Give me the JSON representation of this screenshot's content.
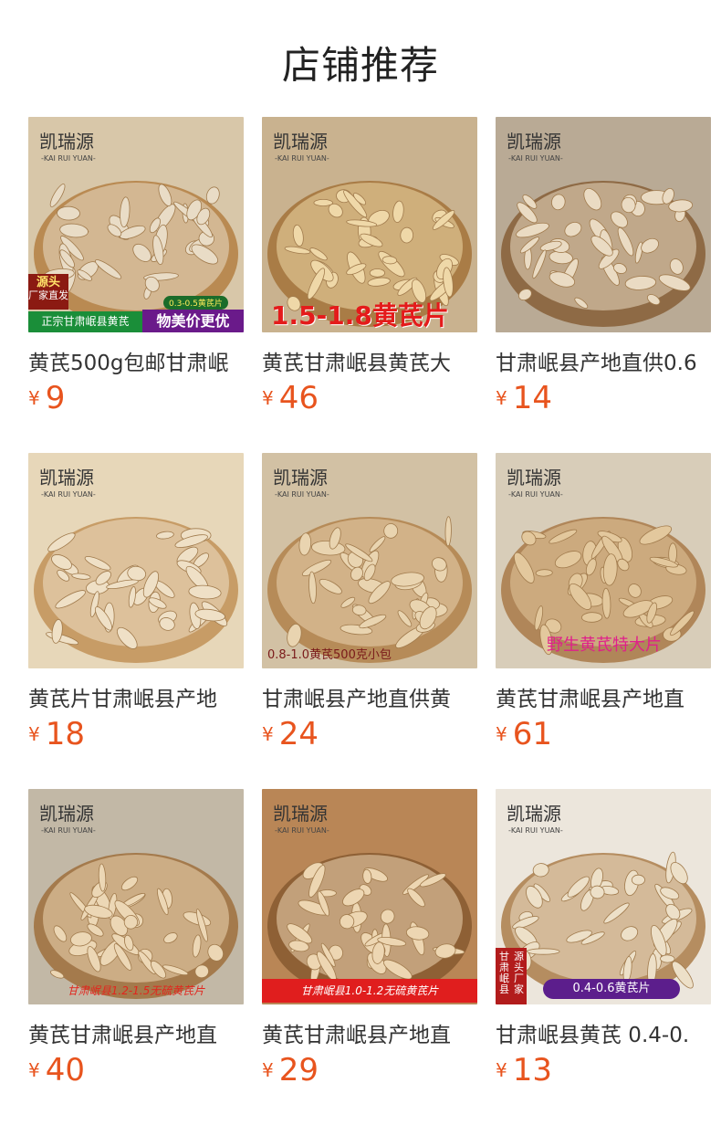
{
  "section_title": "店铺推荐",
  "currency_symbol": "¥",
  "brand": "凯瑞源",
  "brand_en": "KAI RUI YUAN",
  "products": [
    {
      "name": "黄芪500g包邮甘肃岷",
      "price": "9",
      "overlay": [
        "源头",
        "厂家直发",
        "0.3-0.5黄芪片",
        "正宗甘肃岷县黄芪",
        "物美价更优"
      ],
      "bg": "#d8c7a9",
      "plate": "#b98a52",
      "slice": "#e9dcc6"
    },
    {
      "name": "黄芪甘肃岷县黄芪大",
      "price": "46",
      "overlay": [
        "1.5-1.8黄芪片"
      ],
      "bg": "#c9b28f",
      "plate": "#a97c46",
      "slice": "#efd8a8"
    },
    {
      "name": "甘肃岷县产地直供0.6",
      "price": "14",
      "overlay": [],
      "bg": "#b9aa95",
      "plate": "#8e6a45",
      "slice": "#eadbc3"
    },
    {
      "name": "黄芪片甘肃岷县产地",
      "price": "18",
      "overlay": [],
      "bg": "#e7d7b9",
      "plate": "#c79c66",
      "slice": "#efe0c6"
    },
    {
      "name": "甘肃岷县产地直供黄",
      "price": "24",
      "overlay": [
        "0.8-1.0黄芪500克小包"
      ],
      "bg": "#d2c1a4",
      "plate": "#b68b58",
      "slice": "#e9d4b0"
    },
    {
      "name": "黄芪甘肃岷县产地直",
      "price": "61",
      "overlay": [
        "野生黄芪特大片"
      ],
      "bg": "#d8cdb9",
      "plate": "#b08659",
      "slice": "#e3c89d"
    },
    {
      "name": "黄芪甘肃岷县产地直",
      "price": "40",
      "overlay": [
        "甘肃岷县1.2-1.5无硫黄芪片"
      ],
      "bg": "#c2b8a6",
      "plate": "#a47a4c",
      "slice": "#ecd7b5"
    },
    {
      "name": "黄芪甘肃岷县产地直",
      "price": "29",
      "overlay": [
        "甘肃岷县1.0-1.2无硫黄芪片"
      ],
      "bg": "#b98656",
      "plate": "#8e6035",
      "slice": "#edd6b2"
    },
    {
      "name": "甘肃岷县黄芪 0.4-0.",
      "price": "13",
      "overlay": [
        "源头厂家",
        "甘肃岷县",
        "0.4-0.6黄芪片"
      ],
      "bg": "#ece6dc",
      "plate": "#b58d60",
      "slice": "#ede0c8"
    }
  ]
}
